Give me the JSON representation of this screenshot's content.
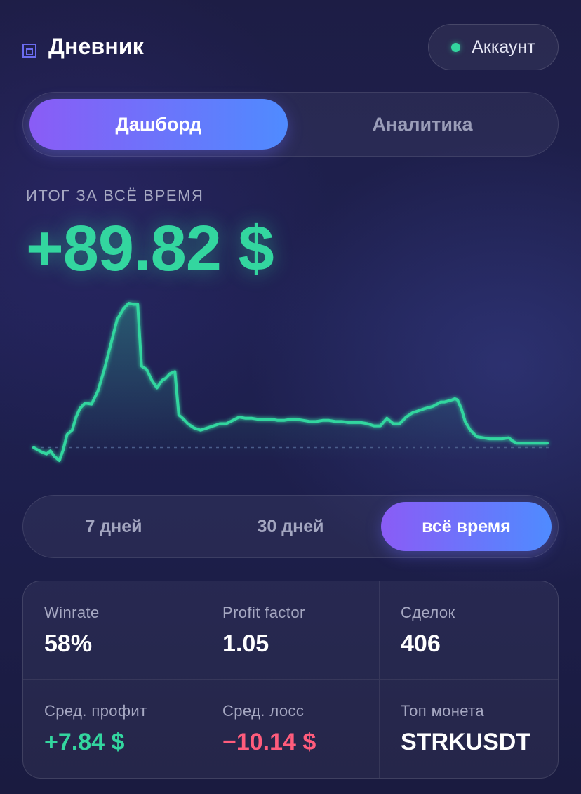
{
  "header": {
    "title": "Дневник",
    "account_label": "Аккаунт",
    "status_color": "#33d69f",
    "logo_icon": "layout-square-icon"
  },
  "tabs": [
    {
      "label": "Дашборд",
      "active": true
    },
    {
      "label": "Аналитика",
      "active": false
    }
  ],
  "summary": {
    "label": "ИТОГ ЗА ВСЁ ВРЕМЯ",
    "value": "+89.82 $",
    "color": "#33d69f"
  },
  "periods": [
    {
      "label": "7 дней",
      "active": false
    },
    {
      "label": "30 дней",
      "active": false
    },
    {
      "label": "всё время",
      "active": true
    }
  ],
  "stats": [
    {
      "label": "Winrate",
      "value": "58%",
      "tone": "neutral"
    },
    {
      "label": "Profit factor",
      "value": "1.05",
      "tone": "neutral"
    },
    {
      "label": "Сделок",
      "value": "406",
      "tone": "neutral"
    },
    {
      "label": "Сред. профит",
      "value": "+7.84 $",
      "tone": "positive"
    },
    {
      "label": "Сред. лосс",
      "value": "−10.14 $",
      "tone": "negative"
    },
    {
      "label": "Топ монета",
      "value": "STRKUSDT",
      "tone": "neutral"
    }
  ],
  "colors": {
    "accent_start": "#8a5cf6",
    "accent_end": "#4f8bff",
    "positive": "#33d69f",
    "negative": "#ff5c7c"
  },
  "chart_data": {
    "type": "line",
    "x": [
      0,
      3,
      6,
      10,
      13,
      16,
      20,
      23,
      26,
      30,
      33,
      36,
      40,
      45,
      50,
      55,
      60,
      65,
      70,
      74,
      78,
      81,
      84,
      88,
      92,
      96,
      100,
      103,
      106,
      110,
      113,
      116,
      120,
      125,
      130,
      135,
      140,
      145,
      150,
      155,
      160,
      165,
      170,
      175,
      180,
      186,
      190,
      195,
      200,
      205,
      210,
      215,
      220,
      225,
      230,
      235,
      240,
      245,
      250,
      255,
      260,
      265,
      270,
      275,
      280,
      285,
      290,
      295,
      300,
      305,
      308,
      311,
      314,
      317,
      320,
      323,
      326,
      328,
      330,
      333,
      336,
      340,
      345,
      350,
      355,
      360,
      365,
      370,
      373,
      376,
      380,
      383,
      387,
      390,
      393,
      396,
      400
    ],
    "values": [
      0,
      -2,
      -4,
      -6,
      -3,
      -8,
      -12,
      -2,
      12,
      16,
      28,
      36,
      41,
      40,
      52,
      72,
      95,
      118,
      128,
      133,
      132,
      132,
      75,
      72,
      62,
      55,
      62,
      64,
      68,
      70,
      30,
      27,
      22,
      18,
      16,
      18,
      20,
      22,
      22,
      25,
      28,
      27,
      27,
      26,
      26,
      26,
      25,
      25,
      26,
      26,
      25,
      24,
      24,
      25,
      25,
      24,
      24,
      23,
      23,
      23,
      22,
      20,
      20,
      27,
      22,
      22,
      28,
      32,
      34,
      36,
      37,
      38,
      40,
      42,
      42,
      43,
      44,
      45,
      44,
      36,
      24,
      16,
      10,
      9,
      8,
      8,
      8,
      9,
      6,
      4,
      4,
      4,
      4,
      4,
      4,
      4,
      4
    ],
    "baseline": 0,
    "color": "#33d69f",
    "title": "",
    "xlabel": "",
    "ylabel": "",
    "grid": false
  }
}
